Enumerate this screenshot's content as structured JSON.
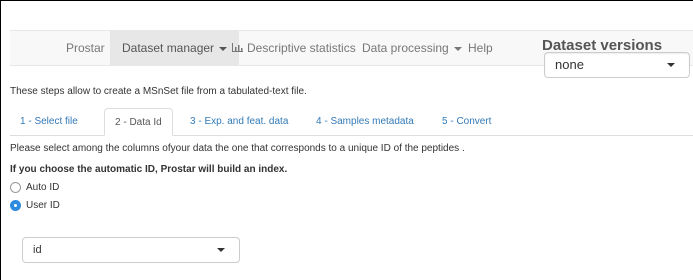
{
  "navbar": {
    "items": [
      {
        "label": "Prostar"
      },
      {
        "label": "Dataset manager"
      },
      {
        "label": "Descriptive statistics"
      },
      {
        "label": "Data processing"
      },
      {
        "label": "Help"
      }
    ]
  },
  "dataset_versions": {
    "title": "Dataset versions",
    "selected": "none"
  },
  "intro_text": "These steps allow to create a MSnSet file from a tabulated-text file.",
  "tabs": [
    {
      "label": "1 - Select file"
    },
    {
      "label": "2 - Data Id"
    },
    {
      "label": "3 - Exp. and feat. data"
    },
    {
      "label": "4 - Samples metadata"
    },
    {
      "label": "5 - Convert"
    }
  ],
  "instruction": "Please select among the columns ofyour data the one that corresponds to a unique ID of the peptides .",
  "auto_id_note": "If you choose the automatic ID, Prostar will build an index.",
  "radios": [
    {
      "label": "Auto ID",
      "checked": false
    },
    {
      "label": "User ID",
      "checked": true
    }
  ],
  "id_select": {
    "selected": "id"
  },
  "colors": {
    "accent": "#2f8be0",
    "link": "#337ab7",
    "navbar_bg": "#f8f8f8"
  }
}
